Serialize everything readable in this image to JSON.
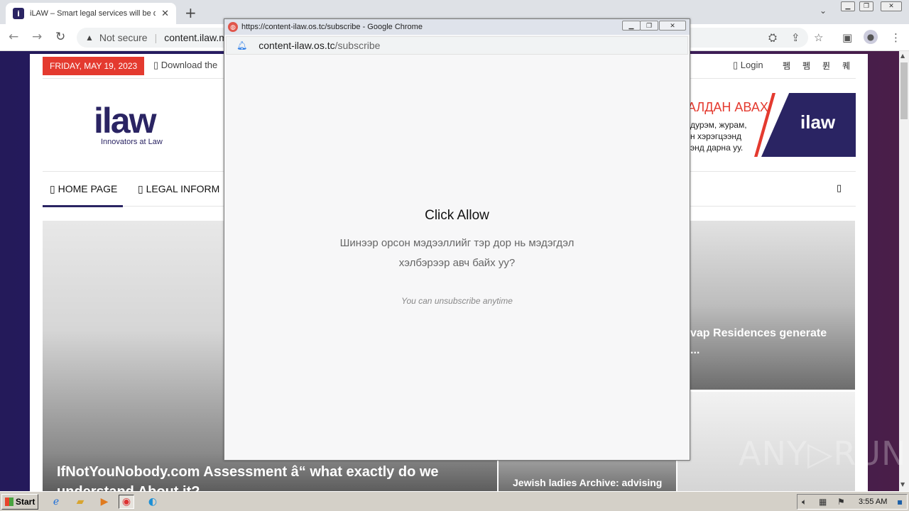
{
  "browser": {
    "tab_title": "iLAW – Smart legal services will be d",
    "tab_favicon": "i",
    "address_warning": "Not secure",
    "address_url": "content.ilaw.mn",
    "icons": [
      "back-icon",
      "forward-icon",
      "reload-icon",
      "warning-icon",
      "translate-icon",
      "share-icon",
      "star-icon",
      "sidebar-icon",
      "profile-icon",
      "menu-icon"
    ]
  },
  "site": {
    "date": "FRIDAY, MAY 19, 2023",
    "download_text": "Download the",
    "login_label": "Login",
    "social": [
      "펨",
      "펨",
      "퓐",
      "퀘"
    ],
    "logo_word": "ilaw",
    "logo_tagline": "Innovators at Law",
    "banner": {
      "headline": "АЛДАН АВАХ",
      "line1": "дурэм, журам,",
      "line2": "н хэрэгцээнд",
      "line3": "энд дарна уу.",
      "logo": "ilaw"
    },
    "nav": [
      {
        "label": "HOME PAGE"
      },
      {
        "label": "LEGAL INFORM"
      }
    ],
    "hero_title": "IfNotYouNobody.com Assessment â“ what exactly do we understand About it?",
    "side1_title": "vap Residences generate",
    "side1_more": "...",
    "side2_title": "Jewish ladies Archive: advising"
  },
  "popup": {
    "window_title": "https://content-ilaw.os.tc/subscribe - Google Chrome",
    "url_host": "content-ilaw.os.tc",
    "url_path": "/subscribe",
    "heading": "Click Allow",
    "message": "Шинээр орсон мэдээллийг тэр дор нь мэдэгдэл хэлбэрээр авч байх уу?",
    "note": "You can unsubscribe anytime"
  },
  "watermark": "ANY▷RUN",
  "taskbar": {
    "start_label": "Start",
    "clock": "3:55 AM"
  }
}
